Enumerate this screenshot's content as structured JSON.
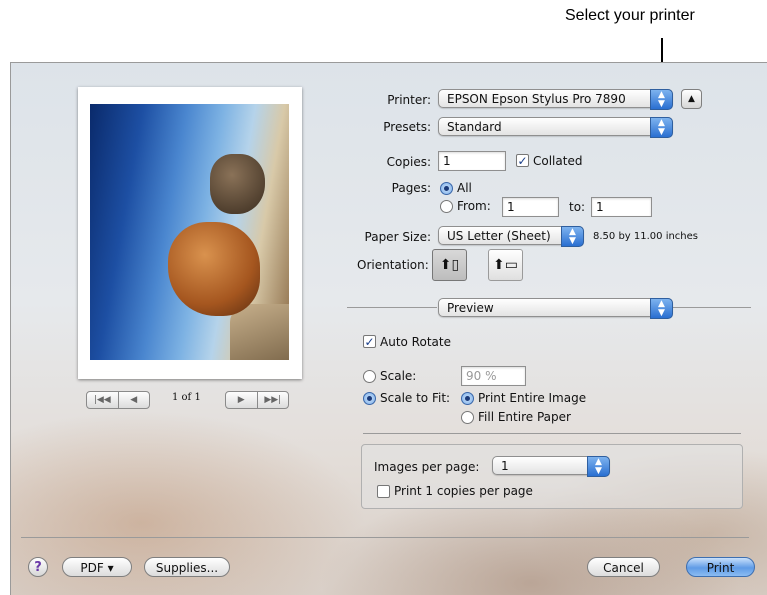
{
  "callout": {
    "text": "Select your printer"
  },
  "printer": {
    "label": "Printer:",
    "value": "EPSON Epson Stylus Pro 7890"
  },
  "presets": {
    "label": "Presets:",
    "value": "Standard"
  },
  "copies": {
    "label": "Copies:",
    "value": "1",
    "collated_label": "Collated",
    "collated_checked": true
  },
  "pages": {
    "label": "Pages:",
    "all_label": "All",
    "from_label": "From:",
    "from_value": "1",
    "to_label": "to:",
    "to_value": "1"
  },
  "paper_size": {
    "label": "Paper Size:",
    "value": "US Letter (Sheet)",
    "dimensions": "8.50 by 11.00 inches"
  },
  "orientation": {
    "label": "Orientation:",
    "portrait_icon": "portrait-orientation-icon",
    "landscape_icon": "landscape-orientation-icon"
  },
  "section": {
    "value": "Preview"
  },
  "auto_rotate": {
    "label": "Auto Rotate",
    "checked": true
  },
  "scale": {
    "label": "Scale:",
    "value": "90 %"
  },
  "scale_to_fit": {
    "label": "Scale to Fit:",
    "option1": "Print Entire Image",
    "option2": "Fill Entire Paper"
  },
  "images_per_page": {
    "label": "Images per page:",
    "value": "1"
  },
  "print_copies": {
    "label": "Print 1 copies per page",
    "checked": false
  },
  "preview_nav": {
    "page_indicator": "1 of 1",
    "first": "|◀◀",
    "prev": "◀",
    "next": "▶",
    "last": "▶▶|"
  },
  "footer": {
    "help": "?",
    "pdf": "PDF ▾",
    "supplies": "Supplies...",
    "cancel": "Cancel",
    "print": "Print"
  }
}
